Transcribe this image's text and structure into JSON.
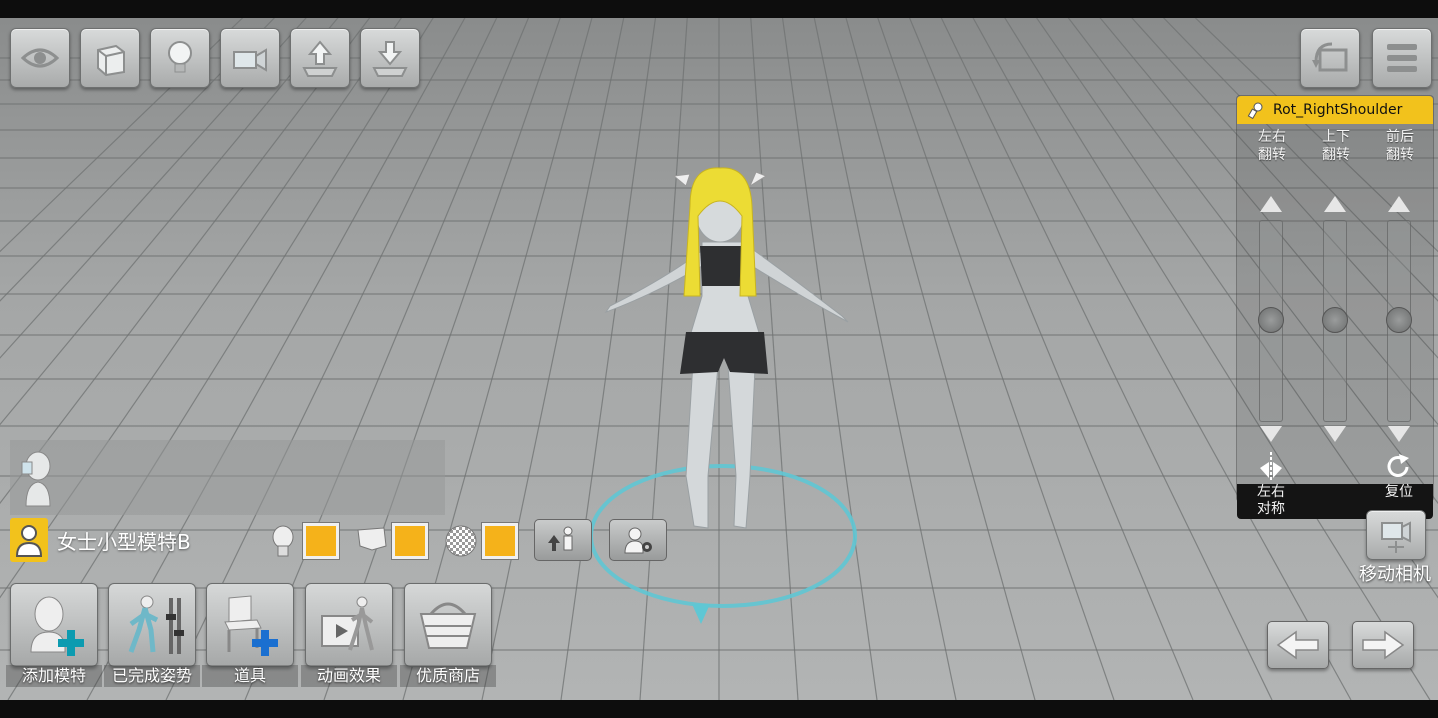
{
  "top_toolbar": {
    "buttons": [
      "eye-icon",
      "cube-icon",
      "light-bulb-icon",
      "camera-view-icon",
      "upload-icon",
      "download-icon"
    ]
  },
  "top_right": {
    "buttons": [
      "reset-view-icon",
      "menu-icon"
    ]
  },
  "rotation_panel": {
    "bone_name": "Rot_RightShoulder",
    "columns": [
      {
        "line1": "左右",
        "line2": "翻转"
      },
      {
        "line1": "上下",
        "line2": "翻转"
      },
      {
        "line1": "前后",
        "line2": "翻转"
      }
    ],
    "mirror": {
      "line1": "左右",
      "line2": "对称"
    },
    "reset": "复位"
  },
  "move_camera_label": "移动相机",
  "model_bar": {
    "name": "女士小型模特B"
  },
  "bottom_toolbar": {
    "add_model": "添加模特",
    "completed_pose": "已完成姿势",
    "props": "道具",
    "animation": "动画效果",
    "store": "优质商店"
  },
  "colors": {
    "accent": "#f2c21c",
    "selection_ring": "#5fc7d4"
  }
}
